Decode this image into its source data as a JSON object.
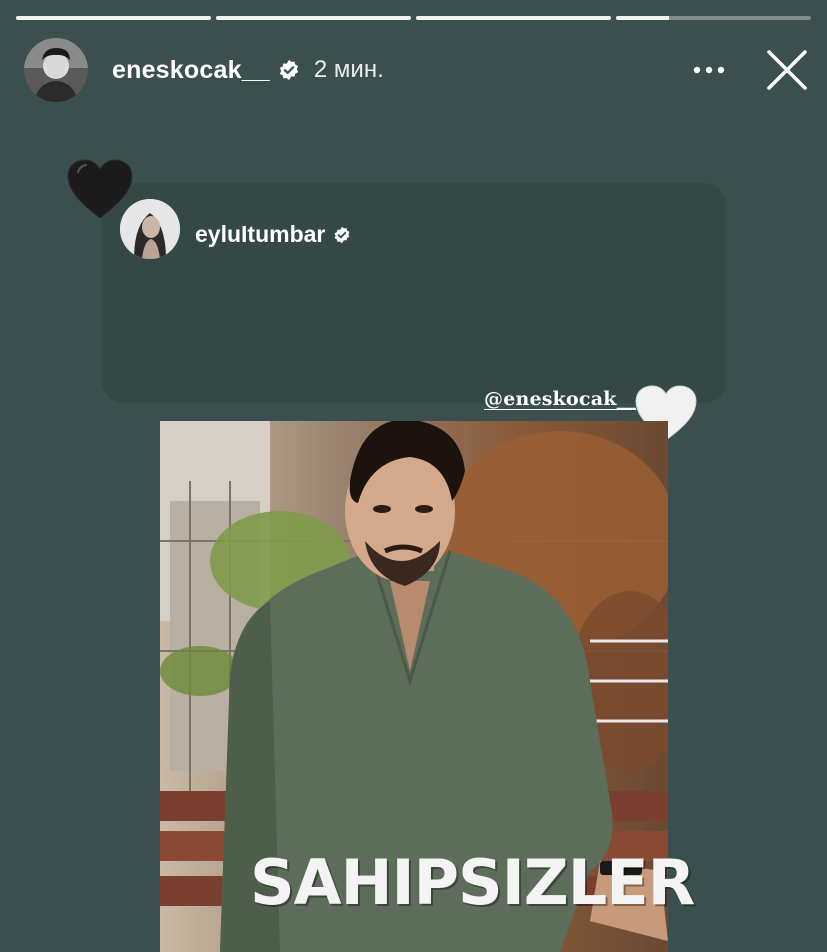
{
  "story": {
    "progress": [
      1,
      1,
      1,
      0.27
    ]
  },
  "header": {
    "username": "eneskocak__",
    "timestamp": "2 мин.",
    "icons": {
      "verified": "verified-badge-icon",
      "more": "more-horizontal-icon",
      "close": "close-icon"
    }
  },
  "shared_post": {
    "username": "eyluItumbar",
    "icons": {
      "verified": "verified-badge-icon"
    }
  },
  "stickers": {
    "black_heart": "black-heart-icon",
    "white_heart": "white-heart-icon",
    "mention": "@eneskocak__"
  },
  "photo": {
    "brand_text": "SAHIPSIZLER"
  },
  "colors": {
    "background": "#3b504e",
    "card": "#344846",
    "progress_done": "#f2f2f2",
    "progress_pending": "rgba(255,255,255,0.35)"
  }
}
